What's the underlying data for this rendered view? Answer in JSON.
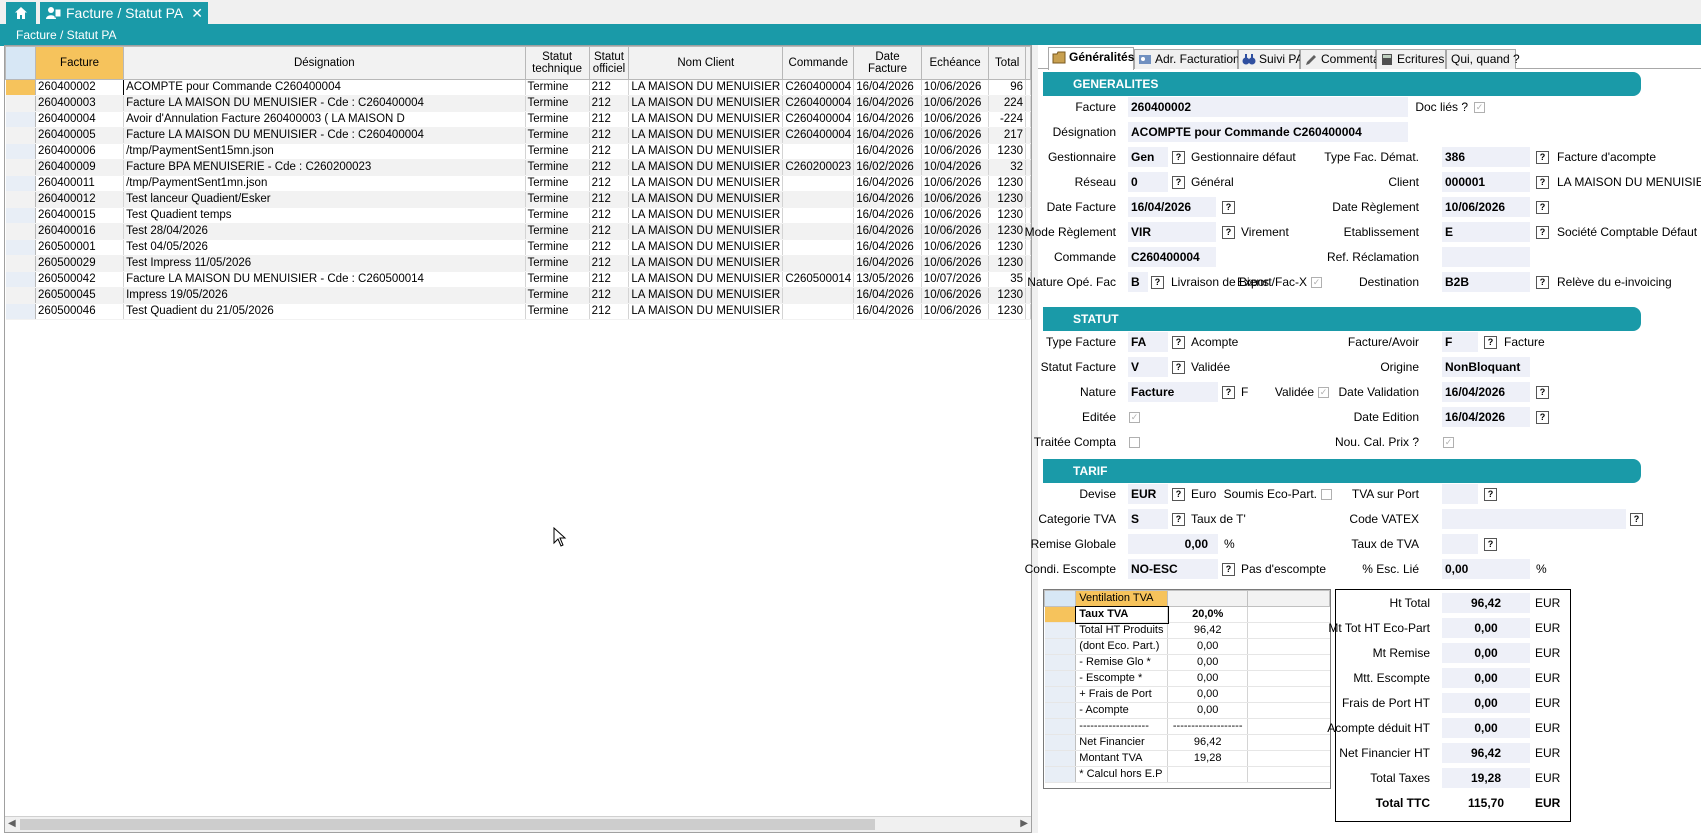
{
  "tabs": {
    "home_icon": "home-icon",
    "doc_icon": "user-document-icon",
    "doc_label": "Facture / Statut PA",
    "close": "✕"
  },
  "breadcrumb": "Facture / Statut PA",
  "grid": {
    "columns": [
      "Facture",
      "Désignation",
      "Statut technique",
      "Statut officiel",
      "Nom Client",
      "Commande",
      "Date Facture",
      "Echéance",
      "Total"
    ],
    "rows": [
      [
        "260400002",
        "ACOMPTE pour Commande C260400004",
        "Termine",
        "212",
        "LA MAISON DU MENUISIER",
        "C260400004",
        "16/04/2026",
        "10/06/2026",
        "96"
      ],
      [
        "260400003",
        "Facture LA MAISON DU MENUISIER - Cde : C260400004",
        "Termine",
        "212",
        "LA MAISON DU MENUISIER",
        "C260400004",
        "16/04/2026",
        "10/06/2026",
        "224"
      ],
      [
        "260400004",
        "Avoir d'Annulation Facture 260400003 ( LA MAISON D",
        "Termine",
        "212",
        "LA MAISON DU MENUISIER",
        "C260400004",
        "16/04/2026",
        "10/06/2026",
        "-224"
      ],
      [
        "260400005",
        "Facture LA MAISON DU MENUISIER - Cde : C260400004",
        "Termine",
        "212",
        "LA MAISON DU MENUISIER",
        "C260400004",
        "16/04/2026",
        "10/06/2026",
        "217"
      ],
      [
        "260400006",
        "/tmp/PaymentSent15mn.json",
        "Termine",
        "212",
        "LA MAISON DU MENUISIER",
        "",
        "16/04/2026",
        "10/06/2026",
        "1230"
      ],
      [
        "260400009",
        "Facture BPA MENUISERIE - Cde : C260200023",
        "Termine",
        "212",
        "LA MAISON DU MENUISIER",
        "C260200023",
        "16/02/2026",
        "10/04/2026",
        "32"
      ],
      [
        "260400011",
        "/tmp/PaymentSent1mn.json",
        "Termine",
        "212",
        "LA MAISON DU MENUISIER",
        "",
        "16/04/2026",
        "10/06/2026",
        "1230"
      ],
      [
        "260400012",
        "Test lanceur Quadient/Esker",
        "Termine",
        "212",
        "LA MAISON DU MENUISIER",
        "",
        "16/04/2026",
        "10/06/2026",
        "1230"
      ],
      [
        "260400015",
        "Test Quadient temps",
        "Termine",
        "212",
        "LA MAISON DU MENUISIER",
        "",
        "16/04/2026",
        "10/06/2026",
        "1230"
      ],
      [
        "260400016",
        "Test 28/04/2026",
        "Termine",
        "212",
        "LA MAISON DU MENUISIER",
        "",
        "16/04/2026",
        "10/06/2026",
        "1230"
      ],
      [
        "260500001",
        "Test 04/05/2026",
        "Termine",
        "212",
        "LA MAISON DU MENUISIER",
        "",
        "16/04/2026",
        "10/06/2026",
        "1230"
      ],
      [
        "260500029",
        "Test Impress 11/05/2026",
        "Termine",
        "212",
        "LA MAISON DU MENUISIER",
        "",
        "16/04/2026",
        "10/06/2026",
        "1230"
      ],
      [
        "260500042",
        "Facture LA MAISON DU MENUISIER - Cde : C260500014",
        "Termine",
        "212",
        "LA MAISON DU MENUISIER",
        "C260500014",
        "13/05/2026",
        "10/07/2026",
        "35"
      ],
      [
        "260500045",
        "Impress 19/05/2026",
        "Termine",
        "212",
        "LA MAISON DU MENUISIER",
        "",
        "16/04/2026",
        "10/06/2026",
        "1230"
      ],
      [
        "260500046",
        "Test Quadient du 21/05/2026",
        "Termine",
        "212",
        "LA MAISON DU MENUISIER",
        "",
        "16/04/2026",
        "10/06/2026",
        "1230"
      ]
    ]
  },
  "right_tabs": [
    {
      "label": "Généralités",
      "icon": "folder-icon"
    },
    {
      "label": "Adr. Facturation",
      "icon": "address-icon"
    },
    {
      "label": "Suivi PA",
      "icon": "binoculars-icon"
    },
    {
      "label": "Commentaire",
      "icon": "pencil-icon"
    },
    {
      "label": "Ecritures",
      "icon": "calculator-icon"
    },
    {
      "label": "Qui, quand ?",
      "icon": ""
    }
  ],
  "generalites": {
    "title": "GENERALITES",
    "facture_label": "Facture",
    "facture": "260400002",
    "doc_lies_label": "Doc liés ?",
    "designation_label": "Désignation",
    "designation": "ACOMPTE pour Commande C260400004",
    "gestionnaire_label": "Gestionnaire",
    "gestionnaire": "Gen",
    "gestionnaire_desc": "Gestionnaire défaut",
    "type_fac_label": "Type Fac. Démat.",
    "type_fac": "386",
    "type_fac_desc": "Facture d'acompte",
    "reseau_label": "Réseau",
    "reseau": "0",
    "reseau_desc": "Général",
    "client_label": "Client",
    "client": "000001",
    "client_desc": "LA MAISON DU MENUISIER",
    "date_facture_label": "Date Facture",
    "date_facture": "16/04/2026",
    "date_reglement_label": "Date Règlement",
    "date_reglement": "10/06/2026",
    "mode_reglement_label": "Mode Règlement",
    "mode_reglement": "VIR",
    "mode_reglement_desc": "Virement",
    "etablissement_label": "Etablissement",
    "etablissement": "E",
    "etablissement_desc": "Société Comptable Défaut",
    "commande_label": "Commande",
    "commande": "C260400004",
    "ref_reclamation_label": "Ref. Réclamation",
    "ref_reclamation": "",
    "nature_ope_label": "Nature Opé. Fac",
    "nature_ope": "B",
    "nature_ope_desc": "Livraison de Biens",
    "export_label": "Export/Fac-X",
    "destination_label": "Destination",
    "destination": "B2B",
    "destination_desc": "Relève du e-invoicing"
  },
  "statut": {
    "title": "STATUT",
    "type_facture_label": "Type Facture",
    "type_facture": "FA",
    "type_facture_desc": "Acompte",
    "facture_avoir_label": "Facture/Avoir",
    "facture_avoir": "F",
    "facture_avoir_desc": "Facture",
    "statut_facture_label": "Statut Facture",
    "statut_facture": "V",
    "statut_facture_desc": "Validée",
    "origine_label": "Origine",
    "origine": "NonBloquant",
    "nature_label": "Nature",
    "nature": "Facture",
    "nature_desc": "F",
    "validee_label": "Validée",
    "date_validation_label": "Date Validation",
    "date_validation": "16/04/2026",
    "editee_label": "Editée",
    "date_edition_label": "Date Edition",
    "date_edition": "16/04/2026",
    "traitee_label": "Traitée Compta",
    "nou_cal_label": "Nou. Cal. Prix ?"
  },
  "tarif": {
    "title": "TARIF",
    "devise_label": "Devise",
    "devise": "EUR",
    "devise_desc": "Euro",
    "soumis_label": "Soumis Eco-Part.",
    "tva_port_label": "TVA sur Port",
    "tva_port": "",
    "categorie_label": "Categorie TVA",
    "categorie": "S",
    "categorie_desc": "Taux de T'",
    "code_vatex_label": "Code VATEX",
    "code_vatex": "",
    "remise_label": "Remise Globale",
    "remise": "0,00",
    "remise_unit": "%",
    "taux_tva_label": "Taux de TVA",
    "taux_tva": "",
    "condi_label": "Condi. Escompte",
    "condi": "NO-ESC",
    "condi_desc": "Pas d'escompte",
    "esc_lie_label": "% Esc. Lié",
    "esc_lie": "0,00",
    "esc_lie_unit": "%"
  },
  "ventilation": {
    "header": "Ventilation TVA",
    "rows": [
      [
        "Taux TVA",
        "20,0%"
      ],
      [
        "Total HT Produits",
        "96,42"
      ],
      [
        "(dont Eco. Part.)",
        "0,00"
      ],
      [
        "- Remise Glo *",
        "0,00"
      ],
      [
        "- Escompte *",
        "0,00"
      ],
      [
        "+ Frais de Port",
        "0,00"
      ],
      [
        "- Acompte",
        "0,00"
      ],
      [
        "-------------------",
        "-------------------"
      ],
      [
        "Net Financier",
        "96,42"
      ],
      [
        "Montant TVA",
        "19,28"
      ],
      [
        "* Calcul hors E.P",
        ""
      ]
    ]
  },
  "totals": [
    {
      "label": "Ht Total",
      "value": "96,42",
      "cur": "EUR"
    },
    {
      "label": "Mt Tot HT Eco-Part",
      "value": "0,00",
      "cur": "EUR"
    },
    {
      "label": "Mt Remise",
      "value": "0,00",
      "cur": "EUR"
    },
    {
      "label": "Mtt. Escompte",
      "value": "0,00",
      "cur": "EUR"
    },
    {
      "label": "Frais de Port HT",
      "value": "0,00",
      "cur": "EUR"
    },
    {
      "label": "Acompte déduit  HT",
      "value": "0,00",
      "cur": "EUR"
    },
    {
      "label": "Net Financier HT",
      "value": "96,42",
      "cur": "EUR"
    },
    {
      "label": "Total Taxes",
      "value": "19,28",
      "cur": "EUR"
    },
    {
      "label": "Total TTC",
      "value": "115,70",
      "cur": "EUR"
    }
  ]
}
